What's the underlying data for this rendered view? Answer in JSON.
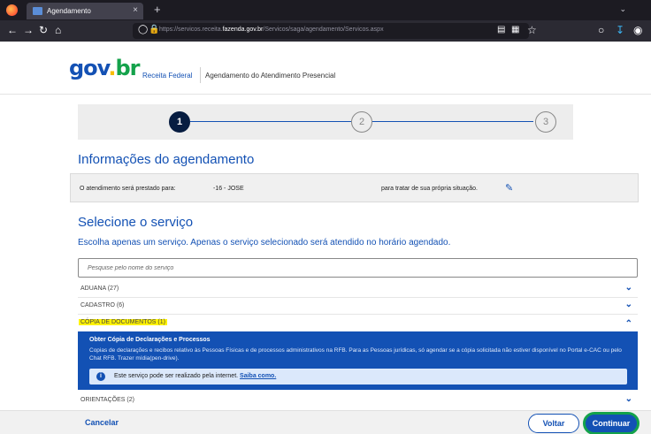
{
  "browser": {
    "tab_title": "Agendamento",
    "tab_close": "×",
    "new_tab": "+",
    "url_prefix": "https://servicos.receita.",
    "url_domain": "fazenda.gov.br",
    "url_path": "/Servicos/saga/agendamento/Servicos.aspx"
  },
  "header": {
    "logo_g": "gov",
    "logo_dot": ".",
    "logo_br": "br",
    "receita": "Receita Federal",
    "agendamento": "Agendamento do Atendimento Presencial"
  },
  "steps": [
    "1",
    "2",
    "3"
  ],
  "info": {
    "title": "Informações do agendamento",
    "label": "O atendimento será prestado para:",
    "person": "-16 - JOSE",
    "situation": "para tratar de sua própria situação."
  },
  "service": {
    "title": "Selecione o serviço",
    "subtitle": "Escolha apenas um serviço. Apenas o serviço selecionado será atendido no horário agendado.",
    "search_placeholder": "Pesquise pelo nome do serviço"
  },
  "categories": [
    {
      "label": "ADUANA (27)"
    },
    {
      "label": "CADASTRO (6)"
    },
    {
      "label": "CÓPIA DE DOCUMENTOS (1)"
    },
    {
      "label": "ORIENTAÇÕES (2)"
    }
  ],
  "expanded": {
    "title": "Obter Cópia de Declarações e Processos",
    "description": "Copias de declarações e recibos relativo às Pessoas Físicas e de processos administrativos na RFB. Para as Pessoas jurídicas, só agendar se a cópia solicitada não estiver disponível no Portal e-CAC ou pelo Chat RFB. Trazer mídia(pen-drive).",
    "notice": "Este serviço pode ser realizado pela internet.",
    "notice_link": "Saiba como."
  },
  "footer": {
    "cancel": "Cancelar",
    "back": "Voltar",
    "continue": "Continuar"
  }
}
